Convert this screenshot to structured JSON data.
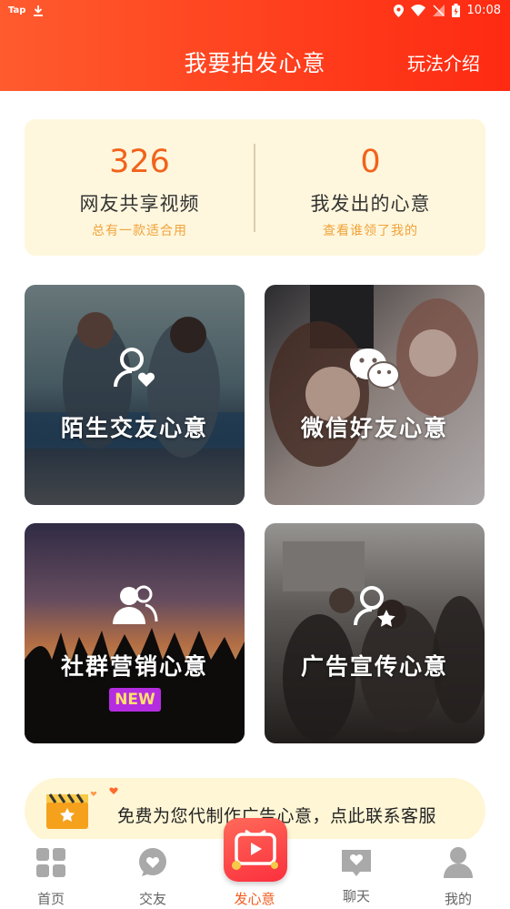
{
  "status_bar": {
    "app_label": "Tap",
    "time": "10:08"
  },
  "header": {
    "title": "我要拍发心意",
    "link": "玩法介绍"
  },
  "stats": {
    "left": {
      "value": "326",
      "label": "网友共享视频",
      "sub": "总有一款适合用"
    },
    "right": {
      "value": "0",
      "label": "我发出的心意",
      "sub": "查看谁领了我的"
    }
  },
  "cards": [
    {
      "label": "陌生交友心意",
      "icon": "user-heart-icon"
    },
    {
      "label": "微信好友心意",
      "icon": "wechat-icon"
    },
    {
      "label": "社群营销心意",
      "icon": "group-icon",
      "badge": "NEW"
    },
    {
      "label": "广告宣传心意",
      "icon": "user-star-icon"
    }
  ],
  "banner": {
    "text": "免费为您代制作广告心意，点此联系客服"
  },
  "tabbar": {
    "items": [
      {
        "label": "首页",
        "icon": "grid-icon"
      },
      {
        "label": "交友",
        "icon": "heart-bubble-icon"
      },
      {
        "label": "发心意",
        "icon": "video-play-icon",
        "active": true
      },
      {
        "label": "聊天",
        "icon": "chat-book-icon"
      },
      {
        "label": "我的",
        "icon": "person-icon"
      }
    ]
  },
  "colors": {
    "header": "#ff4a24",
    "accent": "#f2621b",
    "stats_bg": "#fff7dd",
    "badge": "#b52de0"
  }
}
